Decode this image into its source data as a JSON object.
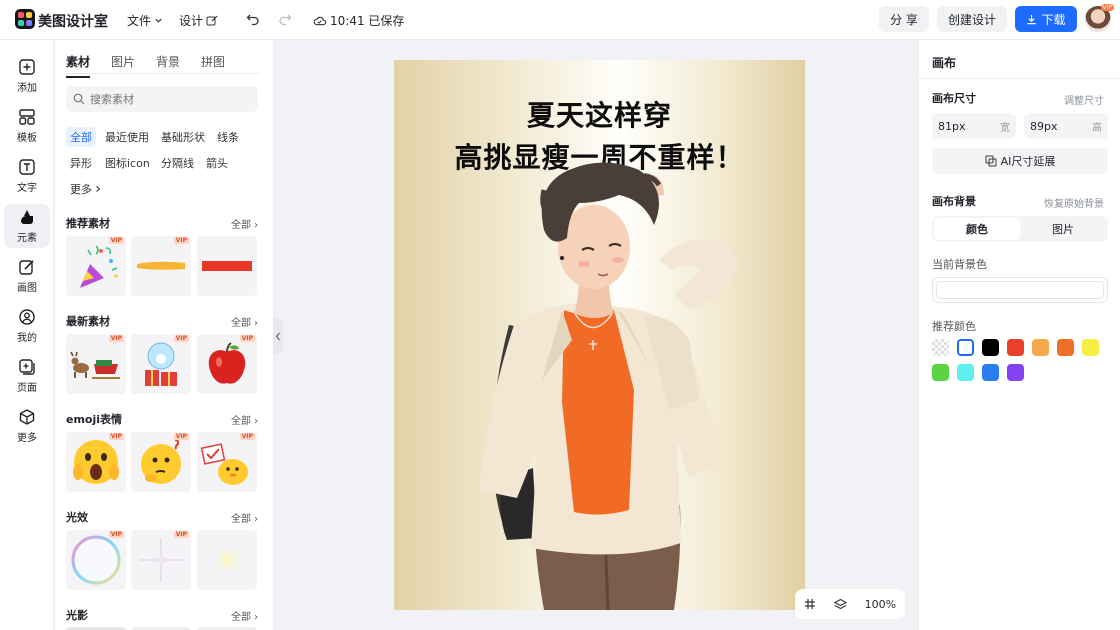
{
  "app": {
    "name": "美图设计室"
  },
  "toolbar": {
    "file_label": "文件",
    "design_label": "设计",
    "saved_status": "10:41 已保存",
    "share_label": "分 享",
    "create_label": "创建设计",
    "download_label": "下载",
    "avatar_badge": "VIP"
  },
  "sidebar": {
    "items": [
      {
        "label": "添加",
        "icon": "plus-square-icon"
      },
      {
        "label": "模板",
        "icon": "template-icon"
      },
      {
        "label": "文字",
        "icon": "text-icon"
      },
      {
        "label": "元素",
        "icon": "shapes-icon"
      },
      {
        "label": "画图",
        "icon": "pen-icon"
      },
      {
        "label": "我的",
        "icon": "user-icon"
      },
      {
        "label": "页面",
        "icon": "page-add-icon"
      },
      {
        "label": "更多",
        "icon": "cube-icon"
      }
    ]
  },
  "panel": {
    "tabs": [
      "素材",
      "图片",
      "背景",
      "拼图"
    ],
    "search_placeholder": "搜索素材",
    "chips": [
      "全部",
      "最近使用",
      "基础形状",
      "线条",
      "异形",
      "图标icon",
      "分隔线",
      "箭头",
      "更多"
    ],
    "sections": [
      {
        "title": "推荐素材",
        "all": "全部"
      },
      {
        "title": "最新素材",
        "all": "全部"
      },
      {
        "title": "emoji表情",
        "all": "全部"
      },
      {
        "title": "光效",
        "all": "全部"
      },
      {
        "title": "光影",
        "all": "全部"
      }
    ],
    "vip_badge": "VIP"
  },
  "canvas": {
    "headline_1": "夏天这样穿",
    "headline_2": "高挑显瘦一周不重样！",
    "zoom": "100%"
  },
  "right_panel": {
    "title": "画布",
    "size_label": "画布尺寸",
    "size_link": "调整尺寸",
    "width_value": "81px",
    "width_unit": "宽",
    "height_value": "89px",
    "height_unit": "高",
    "ai_extend_label": "AI尺寸延展",
    "bg_label": "画布背景",
    "bg_reset": "恢复原始背景",
    "seg_color": "颜色",
    "seg_image": "图片",
    "current_bg_label": "当前背景色",
    "recommended_label": "推荐颜色",
    "swatches": [
      "transparent",
      "#ffffff",
      "#000000",
      "#e8402a",
      "#f5a94a",
      "#f06f28",
      "#f7ee44",
      "#5bd443",
      "#5ef0ec",
      "#2c7df0",
      "#8442ef"
    ]
  },
  "colors": {
    "accent": "#1e6bff"
  }
}
